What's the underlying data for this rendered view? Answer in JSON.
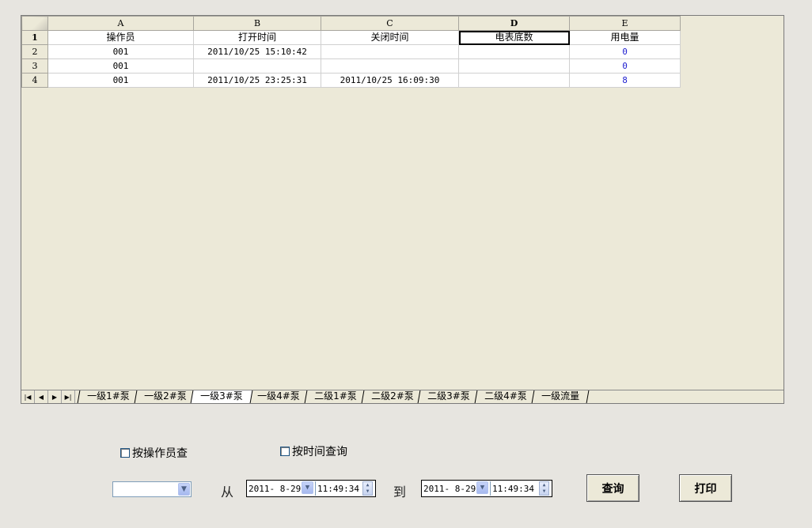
{
  "sheet": {
    "columns": [
      "A",
      "B",
      "C",
      "D",
      "E"
    ],
    "active_column": "D",
    "rows": [
      {
        "num": "1",
        "cells": [
          "操作员",
          "打开时间",
          "关闭时间",
          "电表底数",
          "用电量"
        ]
      },
      {
        "num": "2",
        "cells": [
          "001",
          "2011/10/25 15:10:42",
          "",
          "",
          "0"
        ]
      },
      {
        "num": "3",
        "cells": [
          "001",
          "",
          "",
          "",
          "0"
        ]
      },
      {
        "num": "4",
        "cells": [
          "001",
          "2011/10/25 23:25:31",
          "2011/10/25 16:09:30",
          "",
          "8"
        ]
      }
    ],
    "selected_cell": "D1",
    "tabs": [
      "一级1#泵",
      "一级2#泵",
      "一级3#泵",
      "一级4#泵",
      "二级1#泵",
      "二级2#泵",
      "二级3#泵",
      "二级4#泵",
      "一级流量"
    ],
    "active_tab": 2,
    "nav_icons": [
      "first-sheet-icon",
      "prev-sheet-icon",
      "next-sheet-icon",
      "last-sheet-icon"
    ],
    "colors": {
      "value_blue": "#1f1fd0"
    }
  },
  "filters": {
    "by_operator_label": "按操作员查",
    "by_time_label": "按时间查询",
    "operator_select_value": "",
    "from_label": "从",
    "to_label": "到",
    "from": {
      "date": "2011- 8-29",
      "time": "11:49:34"
    },
    "to": {
      "date": "2011- 8-29",
      "time": "11:49:34"
    }
  },
  "buttons": {
    "query": "查询",
    "print": "打印"
  }
}
